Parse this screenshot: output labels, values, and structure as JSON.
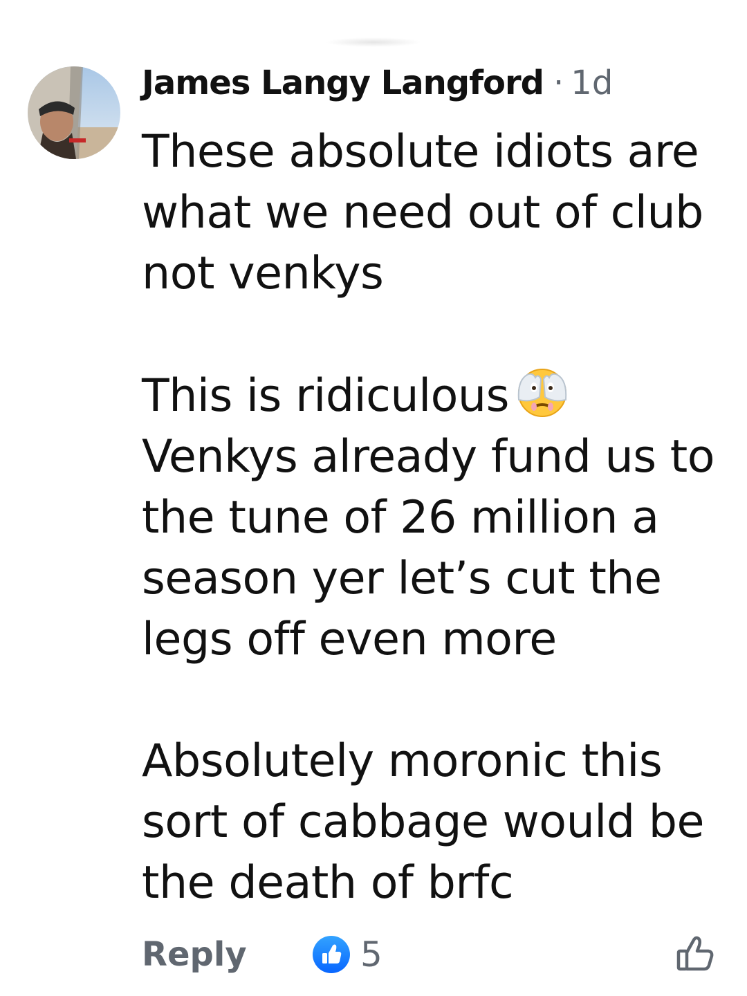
{
  "comment": {
    "author": "James Langy Langford",
    "separator": "·",
    "time_ago": "1d",
    "paragraphs": [
      "These absolute idiots are what we need out of club not venkys",
      "This is ridiculous",
      "Venkys already fund us to the tune of 26 million a season  yer let’s cut the legs off even more",
      "Absolutely moronic  this sort of cabbage would be the death of brfc"
    ],
    "emoji_name": "face-with-open-eyes-and-hand-over-mouth"
  },
  "actions": {
    "reply_label": "Reply",
    "reaction_count": "5",
    "reaction_icon": "like-icon",
    "like_button_icon": "thumbs-up-outline-icon"
  },
  "colors": {
    "text_primary": "#111111",
    "text_secondary": "#606770",
    "like_blue": "#1877F2"
  }
}
